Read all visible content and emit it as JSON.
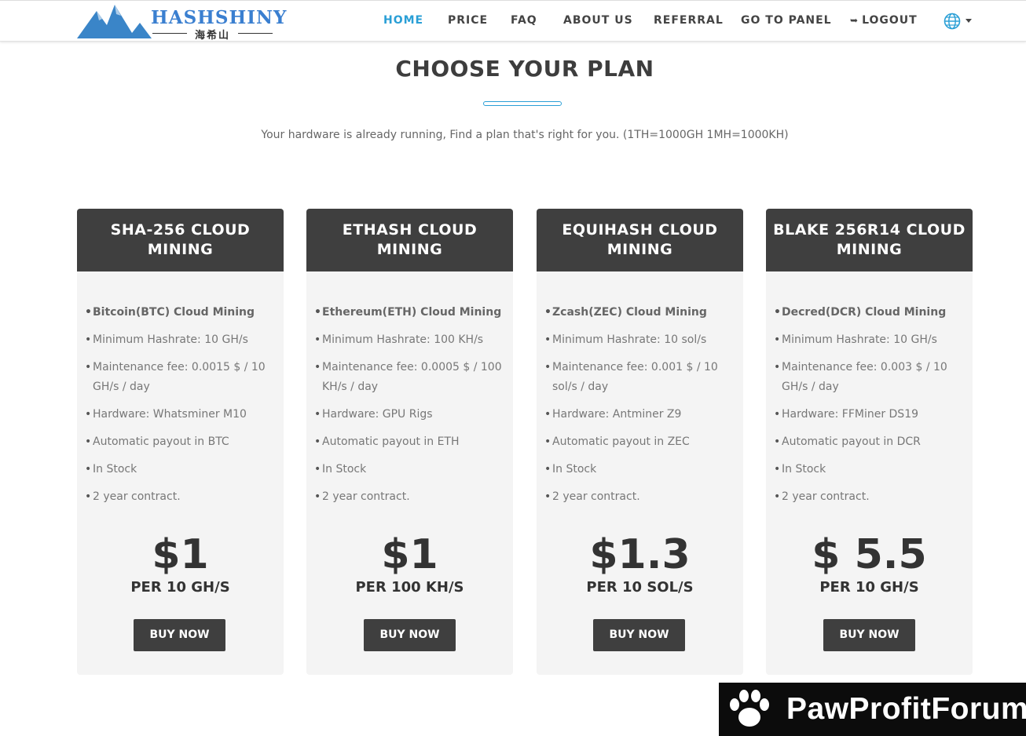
{
  "brand": {
    "name": "HASHSHINY",
    "chinese": "海希山"
  },
  "nav": {
    "items": [
      "HOME",
      "PRICE",
      "FAQ",
      "ABOUT US",
      "REFERRAL",
      "GO TO PANEL",
      "LOGOUT"
    ],
    "active": "HOME",
    "language_icon": "globe-icon"
  },
  "heading": {
    "title": "CHOOSE YOUR PLAN",
    "subtitle": "Your hardware is already running, Find a plan that's right for you. (1TH=1000GH 1MH=1000KH)"
  },
  "plans": [
    {
      "title_line1": "SHA-256 CLOUD",
      "title_line2": "MINING",
      "features": [
        "Bitcoin(BTC) Cloud Mining",
        "Minimum Hashrate: 10 GH/s",
        "Maintenance fee: 0.0015 $ / 10 GH/s / day",
        "Hardware: Whatsminer M10",
        "Automatic payout in BTC",
        "In Stock",
        "2 year contract."
      ],
      "price": "$1",
      "unit": "PER 10 GH/S",
      "button": "BUY NOW"
    },
    {
      "title_line1": "ETHASH CLOUD",
      "title_line2": "MINING",
      "features": [
        "Ethereum(ETH) Cloud Mining",
        "Minimum Hashrate: 100 KH/s",
        "Maintenance fee: 0.0005 $ / 100 KH/s / day",
        "Hardware: GPU Rigs",
        "Automatic payout in ETH",
        "In Stock",
        "2 year contract."
      ],
      "price": "$1",
      "unit": "PER 100 KH/S",
      "button": "BUY NOW"
    },
    {
      "title_line1": "EQUIHASH CLOUD",
      "title_line2": "MINING",
      "features": [
        "Zcash(ZEC) Cloud Mining",
        "Minimum Hashrate: 10 sol/s",
        "Maintenance fee: 0.001 $ / 10 sol/s / day",
        "Hardware: Antminer Z9",
        "Automatic payout in ZEC",
        "In Stock",
        "2 year contract."
      ],
      "price": "$1.3",
      "unit": "PER 10 SOL/S",
      "button": "BUY NOW"
    },
    {
      "title_line1": "BLAKE 256R14 CLOUD",
      "title_line2": "MINING",
      "features": [
        "Decred(DCR) Cloud Mining",
        "Minimum Hashrate: 10 GH/s",
        "Maintenance fee: 0.003 $ / 10 GH/s / day",
        "Hardware: FFMiner DS19",
        "Automatic payout in DCR",
        "In Stock",
        "2 year contract."
      ],
      "price": "$ 5.5",
      "unit": "PER 10 GH/S",
      "button": "BUY NOW"
    }
  ],
  "watermark": {
    "text": "PawProfitForum",
    "icon": "paw-icon"
  },
  "colors": {
    "accent": "#2a9fd6",
    "card_header": "#3f3f3f",
    "card_body": "#f4f4f4",
    "button": "#3f3f3f"
  }
}
